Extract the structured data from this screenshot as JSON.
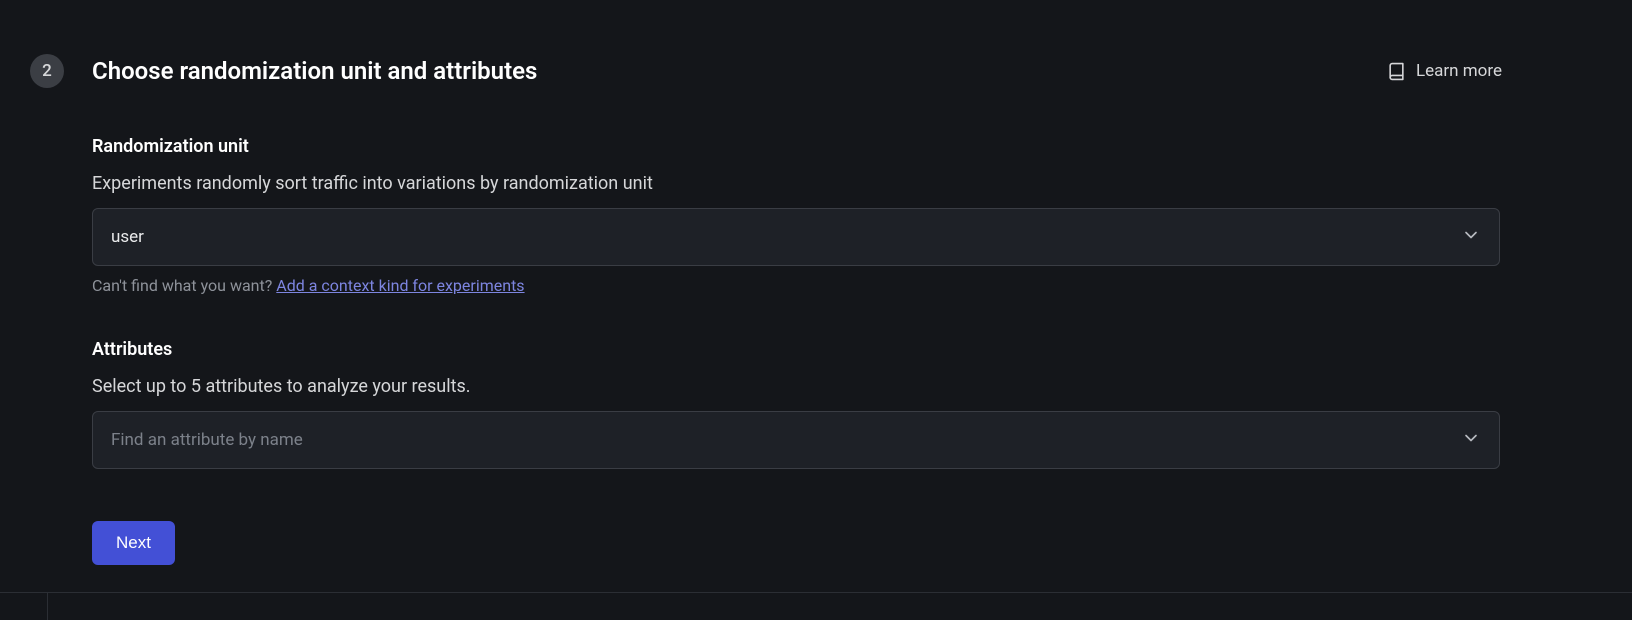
{
  "step": {
    "number": "2",
    "title": "Choose randomization unit and attributes"
  },
  "learn_more": "Learn more",
  "randomization": {
    "label": "Randomization unit",
    "description": "Experiments randomly sort traffic into variations by randomization unit",
    "selected": "user",
    "hint_prefix": "Can't find what you want? ",
    "hint_link": "Add a context kind for experiments"
  },
  "attributes": {
    "label": "Attributes",
    "description": "Select up to 5 attributes to analyze your results.",
    "placeholder": "Find an attribute by name"
  },
  "next_label": "Next"
}
